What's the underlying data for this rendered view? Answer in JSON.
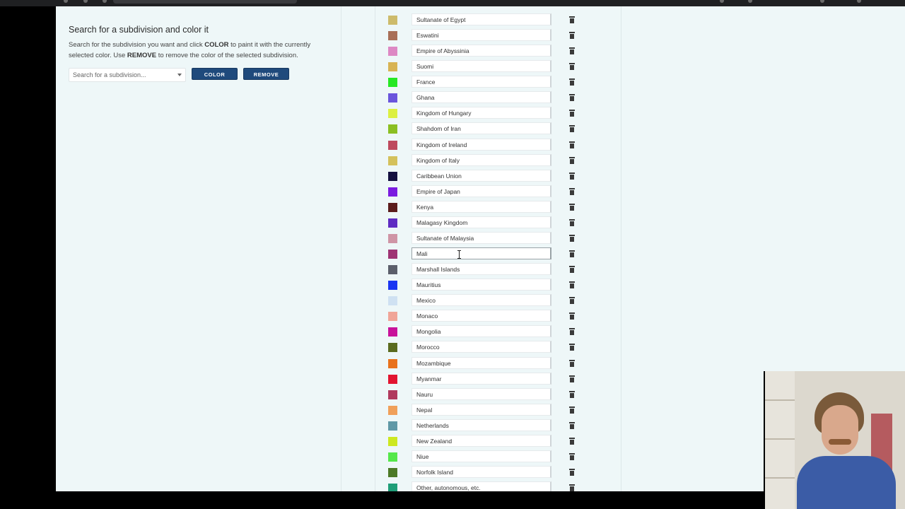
{
  "left_panel": {
    "title": "Search for a subdivision and color it",
    "description_parts": {
      "part1": "Search for the subdivision you want and click ",
      "bold1": "COLOR",
      "part2": " to paint it with the currently selected color. Use ",
      "bold2": "REMOVE",
      "part3": " to remove the color of the selected subdivision."
    },
    "search_placeholder": "Search for a subdivision...",
    "color_button": "COLOR",
    "remove_button": "REMOVE"
  },
  "list": {
    "rows": [
      {
        "name": "Sultanate of Egypt",
        "color": "#cdbb6b"
      },
      {
        "name": "Eswatini",
        "color": "#a86f58"
      },
      {
        "name": "Empire of Abyssinia",
        "color": "#dd88c4"
      },
      {
        "name": "Suomi",
        "color": "#d8b454"
      },
      {
        "name": "France",
        "color": "#27e824"
      },
      {
        "name": "Ghana",
        "color": "#6a55dc"
      },
      {
        "name": "Kingdom of Hungary",
        "color": "#dcf041"
      },
      {
        "name": "Shahdom of Iran",
        "color": "#8bbf22"
      },
      {
        "name": "Kingdom of Ireland",
        "color": "#be4a5e"
      },
      {
        "name": "Kingdom of Italy",
        "color": "#d4c15c"
      },
      {
        "name": "Caribbean Union",
        "color": "#141040"
      },
      {
        "name": "Empire of Japan",
        "color": "#7a1be0"
      },
      {
        "name": "Kenya",
        "color": "#5a1c1c"
      },
      {
        "name": "Malagasy Kingdom",
        "color": "#5e2cc2"
      },
      {
        "name": "Sultanate of Malaysia",
        "color": "#cf95a6"
      },
      {
        "name": "Mali",
        "color": "#9e3474"
      },
      {
        "name": "Marshall Islands",
        "color": "#5b5f6b"
      },
      {
        "name": "Mauritius",
        "color": "#1a35f2"
      },
      {
        "name": "Mexico",
        "color": "#cfe1f2"
      },
      {
        "name": "Monaco",
        "color": "#f0a598"
      },
      {
        "name": "Mongolia",
        "color": "#c8129a"
      },
      {
        "name": "Morocco",
        "color": "#5a6b1f"
      },
      {
        "name": "Mozambique",
        "color": "#e8721c"
      },
      {
        "name": "Myanmar",
        "color": "#e21430"
      },
      {
        "name": "Nauru",
        "color": "#b03a5e"
      },
      {
        "name": "Nepal",
        "color": "#f0a05a"
      },
      {
        "name": "Netherlands",
        "color": "#5f98a6"
      },
      {
        "name": "New Zealand",
        "color": "#cde820"
      },
      {
        "name": "Niue",
        "color": "#55e84a"
      },
      {
        "name": "Norfolk Island",
        "color": "#4d7a27"
      },
      {
        "name": "Other, autonomous, etc.",
        "color": "#1f9e78"
      }
    ],
    "active_row": "Mali"
  }
}
